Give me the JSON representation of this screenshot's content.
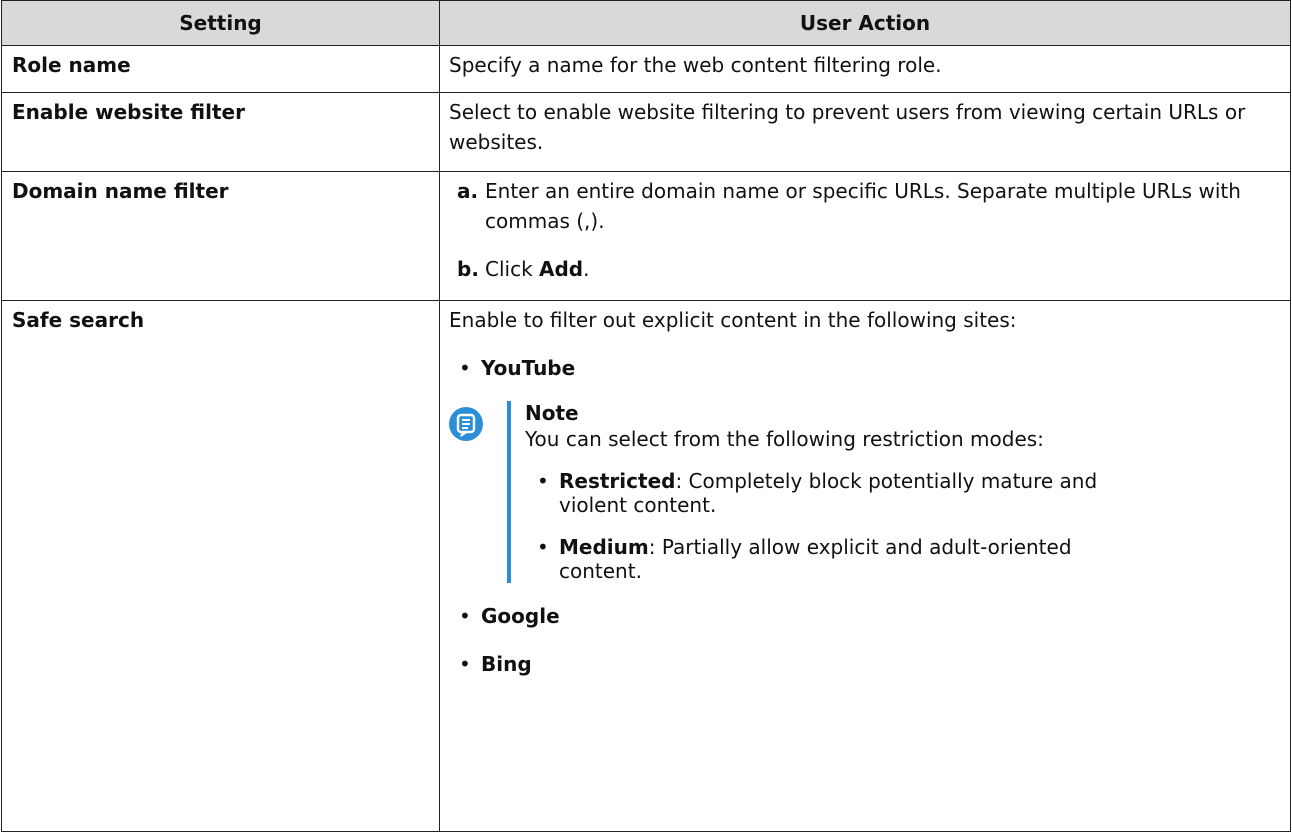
{
  "table": {
    "headers": {
      "setting": "Setting",
      "action": "User Action"
    },
    "rows": [
      {
        "setting": "Role name",
        "action": "Specify a name for the web content filtering role."
      },
      {
        "setting": "Enable website filter",
        "action": "Select to enable website filtering to prevent users from viewing certain URLs or websites."
      },
      {
        "setting": "Domain name filter",
        "steps": [
          {
            "marker": "a.",
            "text": "Enter an entire domain name or specific URLs. Separate multiple URLs with commas (,)."
          },
          {
            "marker": "b.",
            "text_before": "Click ",
            "text_bold": "Add",
            "text_after": "."
          }
        ]
      },
      {
        "setting": "Safe search",
        "intro": "Enable to filter out explicit content in the following sites:",
        "sites": [
          "YouTube",
          "Google",
          "Bing"
        ],
        "note": {
          "title": "Note",
          "text": "You can select from the following restriction modes:",
          "items": [
            {
              "label": "Restricted",
              "text": ": Completely block potentially mature and violent content."
            },
            {
              "label": "Medium",
              "text": ": Partially allow explicit and adult-oriented content."
            }
          ]
        }
      }
    ]
  },
  "bullet_char": "•",
  "colors": {
    "header_bg": "#d9d9d9",
    "note_accent": "#2a8fd8",
    "border": "#222222"
  },
  "icons": {
    "note": "note-icon"
  }
}
